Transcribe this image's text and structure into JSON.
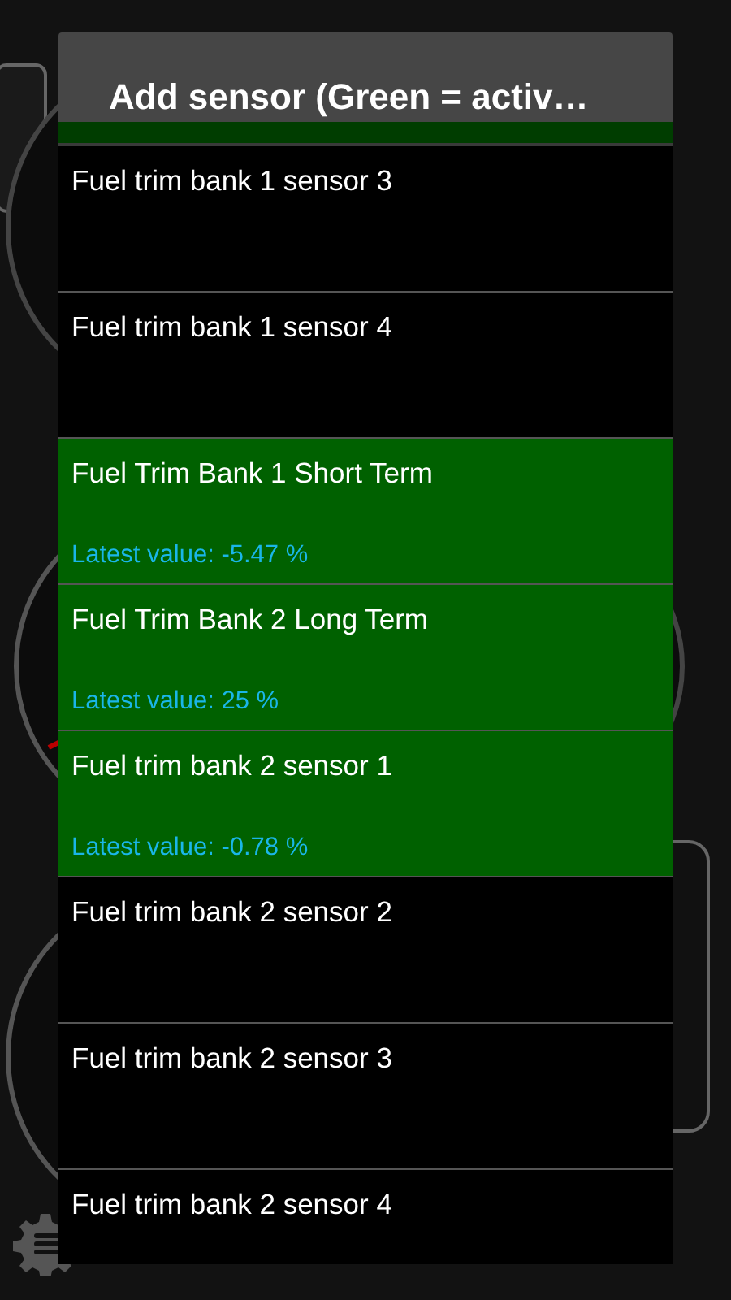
{
  "dialog": {
    "title": "Add sensor (Green  = activ…"
  },
  "scrolled_item_above": {
    "active": true
  },
  "sensors": [
    {
      "name": "Fuel trim bank 1 sensor 3",
      "active": false
    },
    {
      "name": "Fuel trim bank 1 sensor 4",
      "active": false
    },
    {
      "name": "Fuel Trim Bank 1 Short Term",
      "active": true,
      "latest_value": "Latest value: -5.47 %"
    },
    {
      "name": "Fuel Trim Bank 2 Long Term",
      "active": true,
      "latest_value": "Latest value: 25 %"
    },
    {
      "name": "Fuel trim bank 2 sensor 1",
      "active": true,
      "latest_value": "Latest value: -0.78 %"
    },
    {
      "name": "Fuel trim bank 2 sensor 2",
      "active": false
    },
    {
      "name": "Fuel trim bank 2 sensor 3",
      "active": false
    },
    {
      "name": "Fuel trim bank 2 sensor 4",
      "active": false
    }
  ]
}
